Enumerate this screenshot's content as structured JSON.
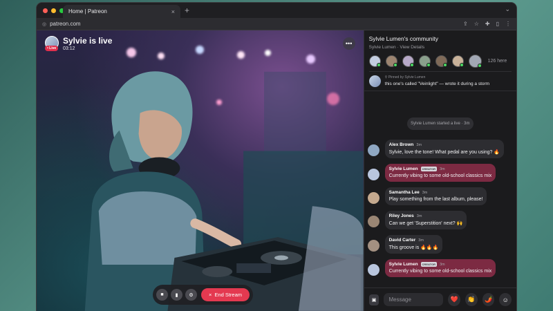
{
  "browser": {
    "tab_title": "Home | Patreon",
    "tab_close": "×",
    "new_tab": "+",
    "url": "patreon.com",
    "traffic_lights": [
      "#ff5f57",
      "#febc2e",
      "#28c840"
    ]
  },
  "stream": {
    "host_name": "Sylvie is live",
    "live_badge": "• Live",
    "elapsed": "03:12",
    "more": "•••",
    "end_label": "End Stream",
    "end_icon": "×",
    "controls": [
      "camera-icon",
      "mic-icon",
      "settings-icon"
    ]
  },
  "community": {
    "title": "Sylvie Lumen's community",
    "subtitle": "Sylvie Lumen · View Details",
    "here_count": "126 here",
    "pinned_meta": "Pinned by Sylvie Lumen",
    "pinned_text": "this one's called \"Veinlight\" — wrote it during a storm",
    "started_text": "Sylvie Lumen started a live · 3m"
  },
  "messages": [
    {
      "name": "Alex Brown",
      "time": "3m",
      "text": "Sylvie, love the tone! What pedal are you using? 🔥",
      "creator": false,
      "avatar": "#8fa7c2"
    },
    {
      "name": "Sylvie Lumen",
      "time": "3m",
      "text": "Currently vibing to some old-school classics mix",
      "creator": true,
      "tag": "CREATOR",
      "avatar": "#b9c6de"
    },
    {
      "name": "Samantha Lee",
      "time": "3m",
      "text": "Play something from the last album, please!",
      "creator": false,
      "avatar": "#c4a98e"
    },
    {
      "name": "Riley Jones",
      "time": "3m",
      "text": "Can we get 'Superstition' next? 🙌",
      "creator": false,
      "avatar": "#9a8674"
    },
    {
      "name": "David Carter",
      "time": "3m",
      "text": "This groove is 🔥🔥🔥",
      "creator": false,
      "avatar": "#a39081"
    },
    {
      "name": "Sylvie Lumen",
      "time": "3m",
      "text": "Currently vibing to some old-school classics mix",
      "creator": true,
      "tag": "CREATOR",
      "avatar": "#b9c6de"
    }
  ],
  "composer": {
    "placeholder": "Message",
    "reactions": [
      "❤️",
      "👏",
      "🌶️"
    ]
  },
  "colors": {
    "accent": "#e43950",
    "creator_bubble": "#7c2a42",
    "online": "#4cd964"
  }
}
